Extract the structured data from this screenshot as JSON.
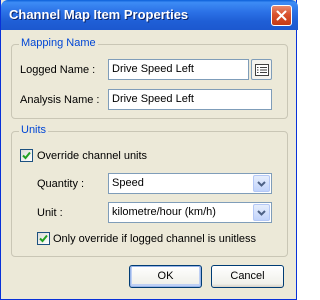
{
  "dialog": {
    "title": "Channel Map Item Properties"
  },
  "mapping": {
    "group_label": "Mapping Name",
    "logged_label": "Logged Name :",
    "logged_value": "Drive Speed Left",
    "analysis_label": "Analysis Name :",
    "analysis_value": "Drive Speed Left"
  },
  "units": {
    "group_label": "Units",
    "override_label": "Override channel units",
    "override_checked": true,
    "quantity_label": "Quantity :",
    "quantity_value": "Speed",
    "unit_label": "Unit :",
    "unit_value": "kilometre/hour (km/h)",
    "only_override_label": "Only override if logged channel is unitless",
    "only_override_checked": true
  },
  "buttons": {
    "ok": "OK",
    "cancel": "Cancel"
  },
  "icons": {
    "close": "close-icon",
    "browse": "list-icon",
    "dropdown": "chevron-down-icon",
    "check": "check-icon"
  }
}
